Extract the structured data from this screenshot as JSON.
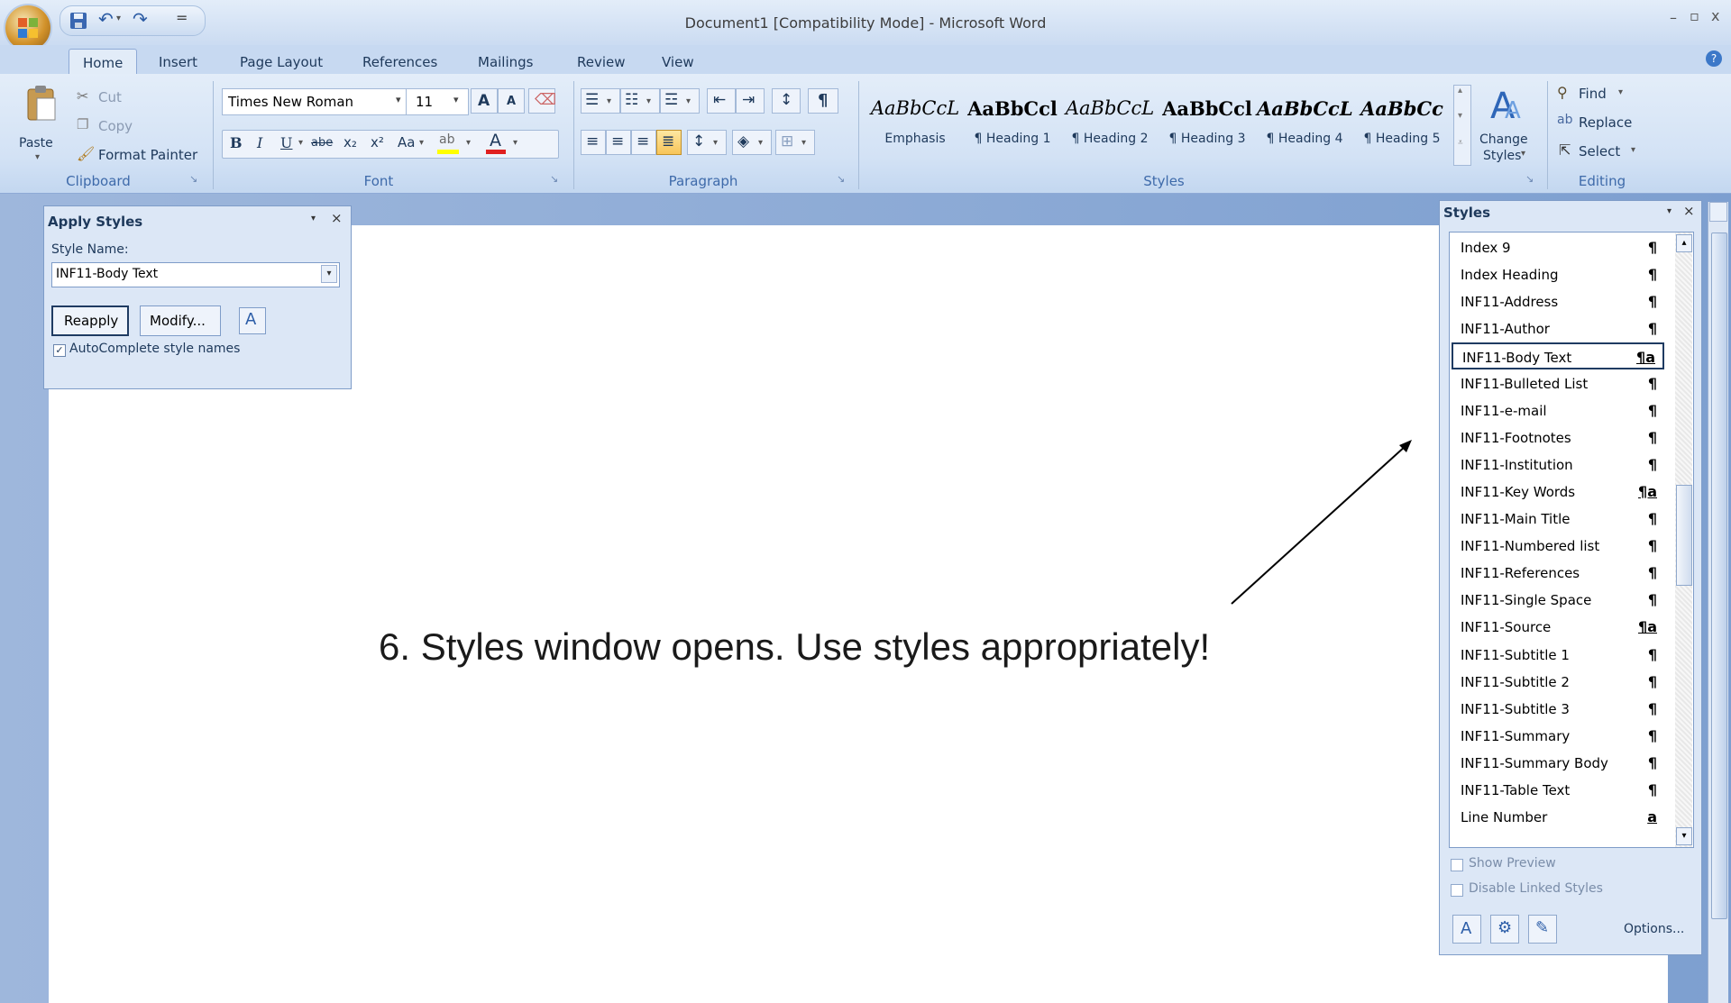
{
  "window": {
    "title": "Document1 [Compatibility Mode] - Microsoft Word",
    "controls": [
      "–",
      "▫",
      "x"
    ]
  },
  "qat": {
    "undo_glyph": "↶",
    "redo_glyph": "↷",
    "customize_glyph": "="
  },
  "tabs": [
    "Home",
    "Insert",
    "Page Layout",
    "References",
    "Mailings",
    "Review",
    "View"
  ],
  "clipboard": {
    "paste": "Paste",
    "cut": "Cut",
    "copy": "Copy",
    "format_painter": "Format Painter",
    "label": "Clipboard"
  },
  "font": {
    "name": "Times New Roman",
    "size": "11",
    "label": "Font",
    "buttons": {
      "bold": "B",
      "italic": "I",
      "underline": "U",
      "strike": "abe",
      "subscript": "x₂",
      "superscript": "x²",
      "case": "Aa",
      "grow": "A",
      "shrink": "A"
    }
  },
  "paragraph": {
    "label": "Paragraph",
    "show_marks": "¶",
    "sort": "↕"
  },
  "styles_gallery": {
    "label": "Styles",
    "items": [
      {
        "preview": "AaBbCcL",
        "name": "Emphasis"
      },
      {
        "preview": "AaBbCcl",
        "name": "¶ Heading 1"
      },
      {
        "preview": "AaBbCcL",
        "name": "¶ Heading 2"
      },
      {
        "preview": "AaBbCcl",
        "name": "¶ Heading 3"
      },
      {
        "preview": "AaBbCcL",
        "name": "¶ Heading 4"
      },
      {
        "preview": "AaBbCc",
        "name": "¶ Heading 5"
      }
    ],
    "change_styles": {
      "line1": "Change",
      "line2": "Styles"
    }
  },
  "editing": {
    "find": "Find",
    "replace": "Replace",
    "select": "Select",
    "label": "Editing"
  },
  "apply_styles": {
    "title": "Apply Styles",
    "style_name_label": "Style Name:",
    "style_name_value": "INF11-Body Text",
    "reapply": "Reapply",
    "modify": "Modify...",
    "autocomplete": "AutoComplete style names"
  },
  "styles_pane": {
    "title": "Styles",
    "items": [
      {
        "name": "Index 9",
        "icon": "¶"
      },
      {
        "name": "Index Heading",
        "icon": "¶"
      },
      {
        "name": "INF11-Address",
        "icon": "¶"
      },
      {
        "name": "INF11-Author",
        "icon": "¶"
      },
      {
        "name": "INF11-Body Text",
        "icon": "¶a"
      },
      {
        "name": "INF11-Bulleted List",
        "icon": "¶"
      },
      {
        "name": "INF11-e-mail",
        "icon": "¶"
      },
      {
        "name": "INF11-Footnotes",
        "icon": "¶"
      },
      {
        "name": "INF11-Institution",
        "icon": "¶"
      },
      {
        "name": "INF11-Key Words",
        "icon": "¶a"
      },
      {
        "name": "INF11-Main Title",
        "icon": "¶"
      },
      {
        "name": "INF11-Numbered list",
        "icon": "¶"
      },
      {
        "name": "INF11-References",
        "icon": "¶"
      },
      {
        "name": "INF11-Single Space",
        "icon": "¶"
      },
      {
        "name": "INF11-Source",
        "icon": "¶a"
      },
      {
        "name": "INF11-Subtitle 1",
        "icon": "¶"
      },
      {
        "name": "INF11-Subtitle 2",
        "icon": "¶"
      },
      {
        "name": "INF11-Subtitle 3",
        "icon": "¶"
      },
      {
        "name": "INF11-Summary",
        "icon": "¶"
      },
      {
        "name": "INF11-Summary Body",
        "icon": "¶"
      },
      {
        "name": "INF11-Table Text",
        "icon": "¶"
      },
      {
        "name": "Line Number",
        "icon": "a"
      }
    ],
    "selected_index": 4,
    "show_preview": "Show Preview",
    "disable_linked": "Disable Linked Styles",
    "options": "Options..."
  },
  "annotation": {
    "text": "6. Styles window opens. Use styles appropriately!"
  },
  "colors": {
    "ribbon_bg": "#dbe8f7",
    "title_bg": "#d3e1f3",
    "doc_frame": "#6f8fc4",
    "selection_border": "#1f3b62"
  }
}
